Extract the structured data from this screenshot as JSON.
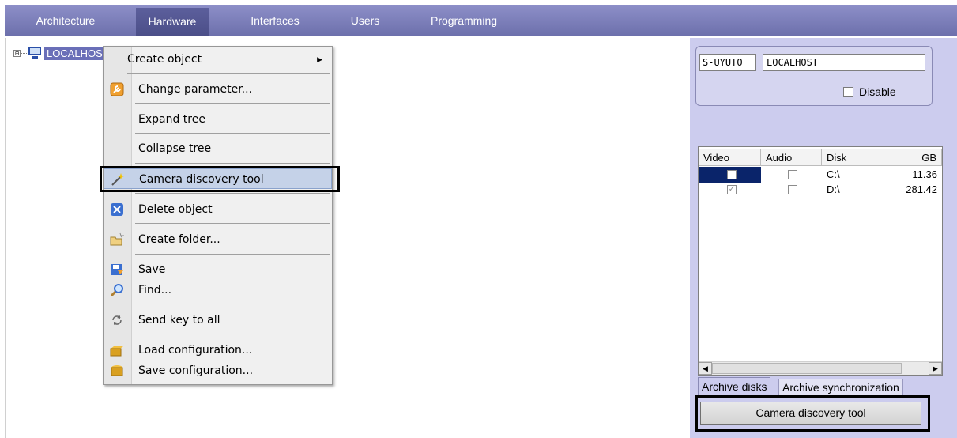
{
  "topbar": {
    "tabs": [
      {
        "label": "Architecture"
      },
      {
        "label": "Hardware"
      },
      {
        "label": "Interfaces"
      },
      {
        "label": "Users"
      },
      {
        "label": "Programming"
      }
    ],
    "active_tab": "Hardware"
  },
  "tree": {
    "expander": "⊞",
    "root_label": "LOCALHOS"
  },
  "context_menu": {
    "items": [
      {
        "label": "Create object",
        "icon": "none",
        "submenu": true
      },
      {
        "label": "Change parameter...",
        "icon": "wrench-icon"
      },
      {
        "label": "Expand tree"
      },
      {
        "label": "Collapse tree"
      },
      {
        "label": "Camera discovery tool",
        "icon": "discovery-wand-icon",
        "highlighted": true
      },
      {
        "label": "Delete object",
        "icon": "delete-icon"
      },
      {
        "label": "Create folder...",
        "icon": "new-folder-icon"
      },
      {
        "label": "Save",
        "icon": "save-icon"
      },
      {
        "label": "Find...",
        "icon": "magnifier-icon"
      },
      {
        "label": "Send key to all",
        "icon": "refresh-icon"
      },
      {
        "label": "Load configuration...",
        "icon": "open-box-icon"
      },
      {
        "label": "Save configuration...",
        "icon": "box-icon"
      }
    ]
  },
  "properties": {
    "code": "S-UYUTO",
    "name": "LOCALHOST",
    "disable_label": "Disable"
  },
  "disks_table": {
    "columns": [
      "Video",
      "Audio",
      "Disk",
      "GB"
    ],
    "rows": [
      {
        "video": false,
        "audio": false,
        "disk": "C:\\",
        "gb": "11.36"
      },
      {
        "video": true,
        "audio": false,
        "disk": "D:\\",
        "gb": "281.42"
      }
    ]
  },
  "right_tabs": {
    "archive_disks": "Archive disks",
    "archive_sync": "Archive synchronization"
  },
  "discovery_button": "Camera discovery tool",
  "colors": {
    "topbar": "#7d80bc",
    "panel": "#ccccee",
    "highlight": "#c5d2e8"
  }
}
